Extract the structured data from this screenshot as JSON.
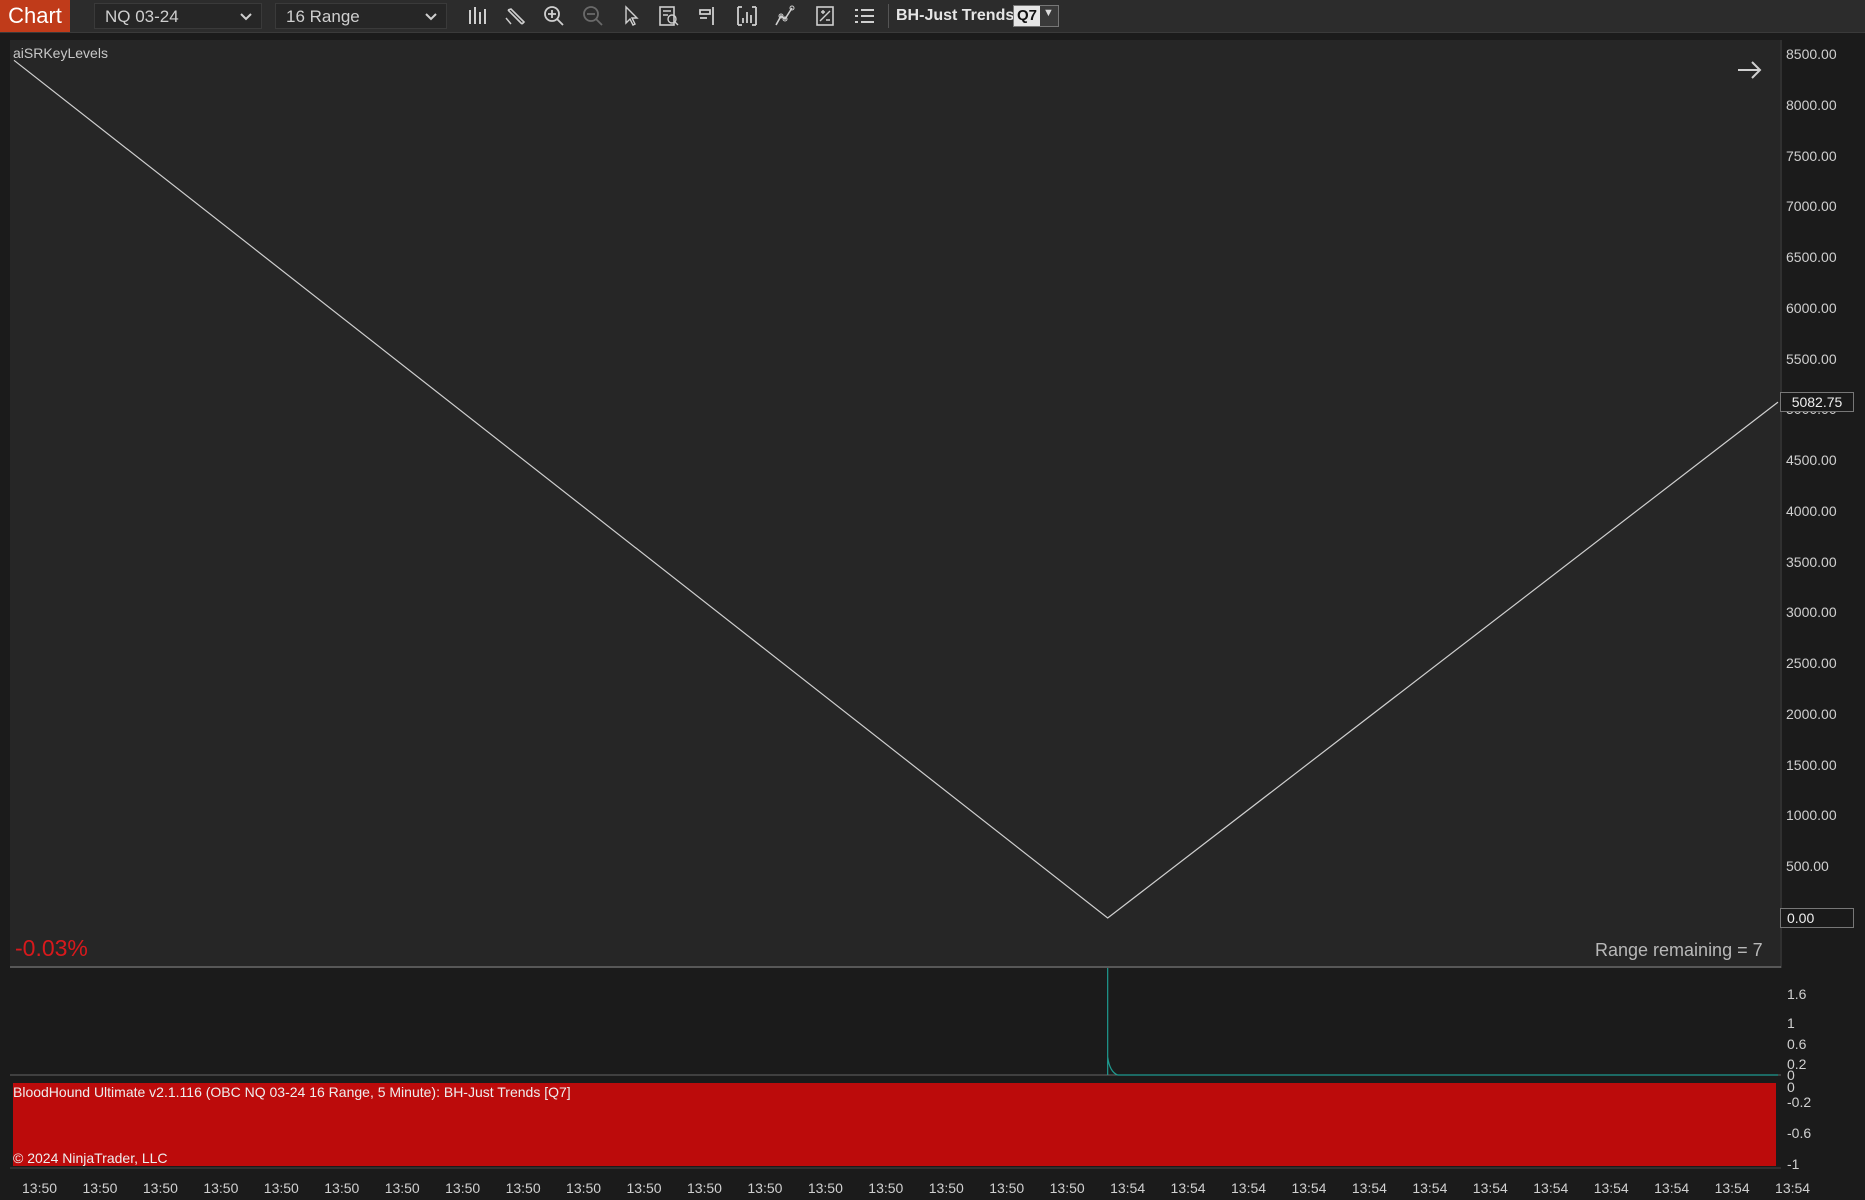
{
  "toolbar": {
    "tab_label": "Chart",
    "instrument": "NQ 03-24",
    "bar_type": "16 Range",
    "strategy_label": "BH-Just Trends",
    "q_label": "Q7",
    "icons": [
      "bar-type-icon",
      "drawing-tool-icon",
      "zoom-in-icon",
      "zoom-out-icon",
      "pointer-icon",
      "data-box-icon",
      "price-marker-icon",
      "indicators-icon",
      "strategies-icon",
      "properties-icon",
      "list-icon"
    ]
  },
  "panel": {
    "indicator_name": "aiSRKeyLevels",
    "pct_change": "-0.03%",
    "range_remaining": "Range remaining = 7",
    "last_price": "5082.75",
    "zero_price": "0.00",
    "overlay_label": "BloodHound Ultimate v2.1.116 (OBC NQ 03-24 16 Range, 5 Minute): BH-Just Trends  [Q7]",
    "copyright": "© 2024 NinjaTrader, LLC"
  },
  "colors": {
    "tab": "#c03b1a",
    "background": "#262626",
    "line": "#cfcfcf",
    "pct": "#d8191c",
    "lower_fill": "#bc0b0b",
    "spike": "#1e9a8f"
  },
  "chart_data": [
    {
      "type": "line",
      "name": "price",
      "y_axis_ticks": [
        "8500.00",
        "8000.00",
        "7500.00",
        "7000.00",
        "6500.00",
        "6000.00",
        "5500.00",
        "5000.00",
        "4500.00",
        "4000.00",
        "3500.00",
        "3000.00",
        "2500.00",
        "2000.00",
        "1500.00",
        "1000.00",
        "500.00"
      ],
      "ylim": [
        0,
        8650
      ],
      "points": [
        {
          "x_index": 0,
          "y": 8450
        },
        {
          "x_index": 0.62,
          "y": 0
        },
        {
          "x_index": 1,
          "y": 5082.75
        }
      ]
    },
    {
      "type": "line",
      "name": "indicator",
      "y_axis_ticks": [
        "1.6",
        "1",
        "0.6",
        "0.2",
        "0",
        "0",
        "-0.2",
        "-0.6",
        "-1"
      ],
      "ylim": [
        -1,
        1.9
      ],
      "spike_x_index": 0.62,
      "spike_value": 1.9
    }
  ],
  "x_axis": {
    "ticks": [
      "13:50",
      "13:50",
      "13:50",
      "13:50",
      "13:50",
      "13:50",
      "13:50",
      "13:50",
      "13:50",
      "13:50",
      "13:50",
      "13:50",
      "13:50",
      "13:50",
      "13:50",
      "13:50",
      "13:50",
      "13:50",
      "13:54",
      "13:54",
      "13:54",
      "13:54",
      "13:54",
      "13:54",
      "13:54",
      "13:54",
      "13:54",
      "13:54",
      "13:54",
      "13:54"
    ]
  }
}
